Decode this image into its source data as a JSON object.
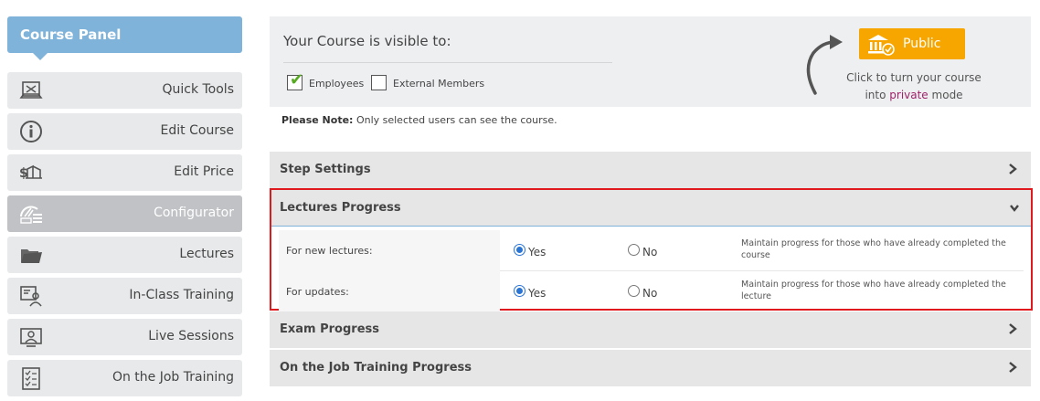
{
  "sidebar": {
    "title": "Course Panel",
    "items": [
      {
        "label": "Quick Tools",
        "icon": "quick-tools-icon"
      },
      {
        "label": "Edit Course",
        "icon": "info-icon"
      },
      {
        "label": "Edit Price",
        "icon": "price-icon"
      },
      {
        "label": "Configurator",
        "icon": "configurator-icon",
        "active": true
      },
      {
        "label": "Lectures",
        "icon": "folder-icon"
      },
      {
        "label": "In-Class Training",
        "icon": "classroom-icon"
      },
      {
        "label": "Live Sessions",
        "icon": "live-session-icon"
      },
      {
        "label": "On the Job Training",
        "icon": "checklist-icon"
      }
    ]
  },
  "visibility": {
    "title": "Your Course is visible to:",
    "employees_label": "Employees",
    "employees_checked": true,
    "external_label": "External Members",
    "external_checked": false,
    "public_button": "Public",
    "hint_before": "Click to turn your course",
    "hint_into": "into",
    "hint_private": "private",
    "hint_after": "mode",
    "note_bold": "Please Note:",
    "note_text": "Only selected users can see the course."
  },
  "sections": {
    "step_settings": "Step Settings",
    "lectures_progress": "Lectures Progress",
    "exam_progress": "Exam Progress",
    "ojt_progress": "On the Job Training Progress"
  },
  "lectures_progress": {
    "rows": [
      {
        "label": "For new lectures:",
        "yes": "Yes",
        "no": "No",
        "selected": "Yes",
        "description": "Maintain progress for those who have already completed the course"
      },
      {
        "label": "For updates:",
        "yes": "Yes",
        "no": "No",
        "selected": "Yes",
        "description": "Maintain progress for those who have already completed the lecture"
      }
    ]
  },
  "colors": {
    "panel_header": "#7fb3d9",
    "public_button": "#f7a600",
    "highlight_border": "#e0191f",
    "private_text": "#a0226a"
  }
}
